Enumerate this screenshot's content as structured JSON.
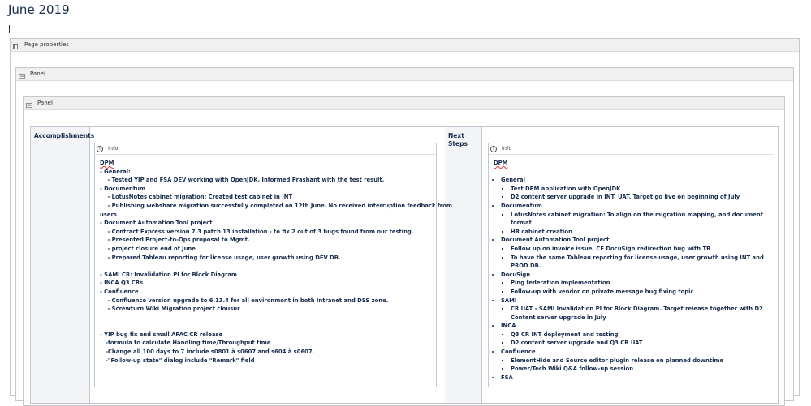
{
  "page": {
    "title": "June 2019"
  },
  "macros": {
    "page_properties": "Page properties",
    "panel_outer": "Panel",
    "panel_inner": "Panel"
  },
  "table": {
    "col1_header": "Accomplishments",
    "col3_header": "Next Steps",
    "info_label": "Info"
  },
  "accomplishments": {
    "title": "DPM",
    "lines": [
      "- General:",
      "    - Tested YIP and FSA DEV working with OpenJDK. Informed Prashant with the test result.",
      "- Documentum",
      "    - LotusNotes cabinet migration: Created test cabinet in INT",
      "    - Publishing webshare migration successfully completed on 12th June. No received interruption feedback from",
      "users",
      "- Document Automation Tool project",
      "    - Contract Express version 7.3 patch 13 installation - to fix 2 out of 3 bugs found from our testing.",
      "    - Presented Project-to-Ops proposal to Mgmt.",
      "    - project closure end of June",
      "    - Prepared Tableau reporting for license usage, user growth using DEV DB.",
      "",
      "- SAMI CR: Invalidation PI for Block Diagram",
      "- INCA Q3 CRs",
      "- Confluence",
      "    - Confluence version upgrade to 6.13.4 for all environment in both Intranet and DSS zone.",
      "    - Screwturn Wiki Migration project clousur",
      "",
      "",
      "- YIP bug fix and small APAC CR release",
      "   -formula to calculate Handling time/Throughput time",
      "   -Change all 100 days to 7 include s0801 à s0607 and s604 à s0607.",
      "   -\"Follow-up state\" dialog include \"Remark\" field"
    ]
  },
  "next_steps": {
    "title": "DPM",
    "groups": [
      {
        "label": "General",
        "items": [
          "Test DPM application with OpenJDK",
          "D2 content server upgrade in INT, UAT. Target go live on beginning of July"
        ]
      },
      {
        "label": "Documentum",
        "items": [
          "LotusNotes cabinet migration: To align on the migration mapping, and document format",
          "HR cabinet creation"
        ]
      },
      {
        "label": "Document Automation Tool project",
        "items": [
          "Follow up on invoice issue, CE DocuSign redirection bug with TR",
          "To have the same Tableau reporting for license usage, user growth using INT and PROD DB."
        ]
      },
      {
        "label": "DocuSign",
        "items": [
          "Ping federation implementation",
          "Follow-up with vendor on private message bug fixing topic"
        ]
      },
      {
        "label": "SAMI",
        "items": [
          "CR UAT - SAMI Invalidation PI for Block Diagram. Target release together with D2 Content server upgrade in July"
        ]
      },
      {
        "label": "INCA",
        "items": [
          "Q3 CR INT deployment and testing",
          "D2 content server upgrade and Q3 CR UAT"
        ]
      },
      {
        "label": "Confluence",
        "items": [
          "ElementHide and Source editor plugin release on planned downtime",
          "Power/Tech Wiki Q&A follow-up session"
        ]
      },
      {
        "label": "FSA",
        "items": []
      }
    ]
  }
}
